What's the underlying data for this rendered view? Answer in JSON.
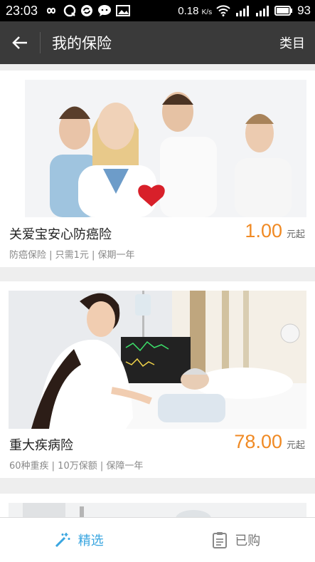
{
  "status_bar": {
    "time": "23:03",
    "net_speed": "0.18",
    "net_unit": "K/s",
    "battery": "93"
  },
  "app_bar": {
    "title": "我的保险",
    "action": "类目"
  },
  "products": [
    {
      "title": "关爱宝安心防癌险",
      "description": "防癌保险 | 只需1元 | 保期一年",
      "price": "1.00",
      "price_unit": "元起"
    },
    {
      "title": "重大疾病险",
      "description": "60种重疾 | 10万保额 | 保障一年",
      "price": "78.00",
      "price_unit": "元起"
    }
  ],
  "bottom_nav": {
    "featured": "精选",
    "purchased": "已购"
  },
  "colors": {
    "accent_blue": "#3aa6e0",
    "price_orange": "#f08a24",
    "app_bar": "#3a3a3a"
  }
}
